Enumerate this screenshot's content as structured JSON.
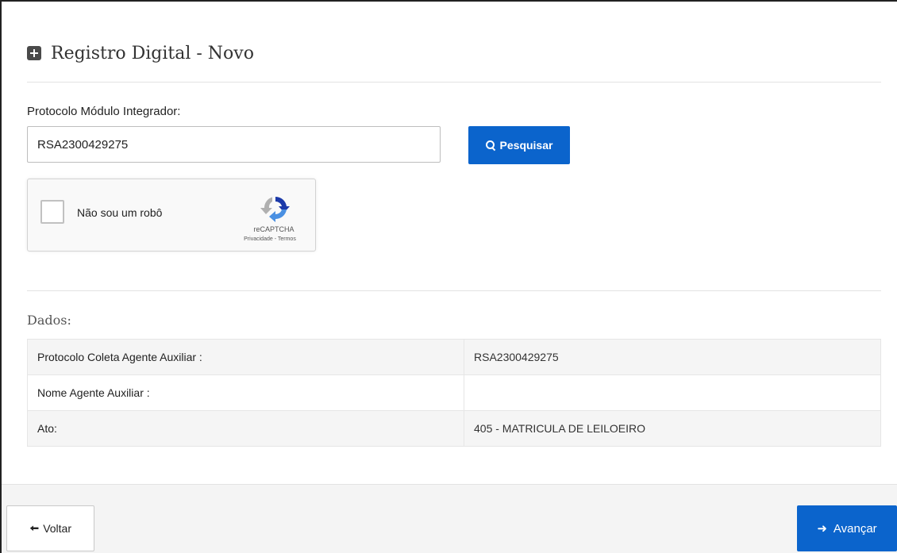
{
  "header": {
    "title": "Registro Digital - Novo",
    "icon": "plus-square-icon"
  },
  "search": {
    "label": "Protocolo Módulo Integrador:",
    "value": "RSA2300429275",
    "button_label": "Pesquisar",
    "button_icon": "search-icon"
  },
  "captcha": {
    "checkbox_label": "Não sou um robô",
    "brand": "reCAPTCHA",
    "privacy": "Privacidade",
    "separator": "-",
    "terms": "Termos"
  },
  "dados": {
    "heading": "Dados:",
    "rows": [
      {
        "label": "Protocolo Coleta Agente Auxiliar :",
        "value": "RSA2300429275"
      },
      {
        "label": "Nome Agente Auxiliar :",
        "value": ""
      },
      {
        "label": "Ato:",
        "value": "405 - MATRICULA DE LEILOEIRO"
      }
    ]
  },
  "footer": {
    "back_label": "Voltar",
    "back_icon": "arrow-left-icon",
    "next_label": "Avançar",
    "next_icon": "arrow-right-icon"
  },
  "colors": {
    "primary": "#0b64cc",
    "footer_bg": "#f4f4f4",
    "row_alt": "#f5f5f5"
  }
}
